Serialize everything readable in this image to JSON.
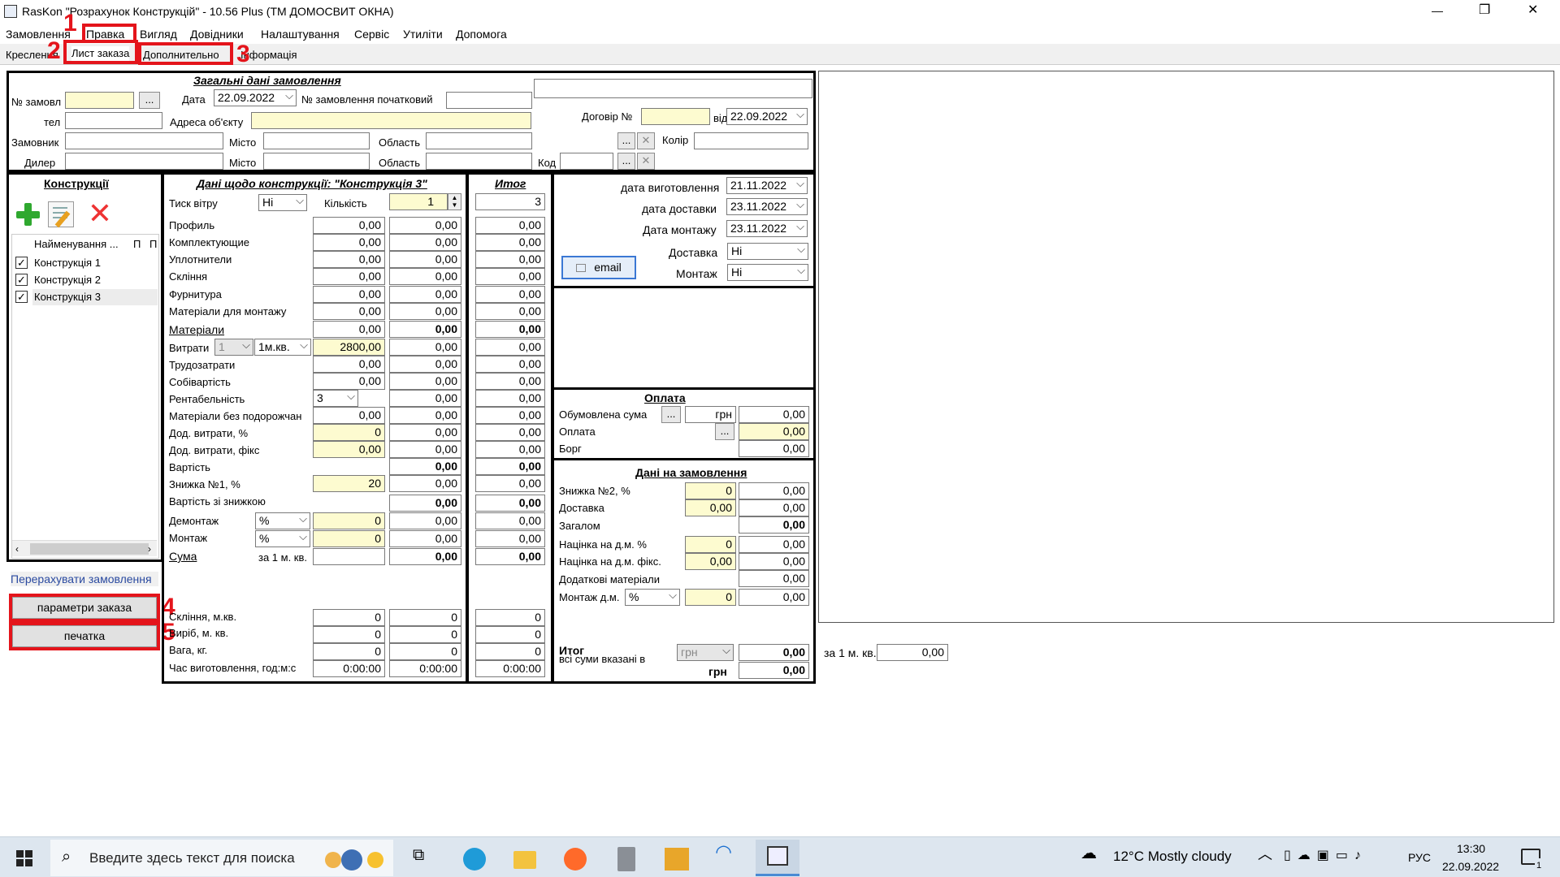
{
  "window": {
    "title": "RasKon \"Розрахунок Конструкцій\" - 10.56 Plus (ТМ ДОМОСВИТ ОКНА)",
    "minimize": "—",
    "maximize": "❐",
    "close": "✕"
  },
  "menu": [
    "Замовлення",
    "Правка",
    "Вигляд",
    "Довідники",
    "Налаштування",
    "Сервіс",
    "Утиліти",
    "Допомога"
  ],
  "tabs": [
    "Креслення",
    "Лист заказа",
    "Дополнительно",
    "Інформація"
  ],
  "markers": [
    "1",
    "2",
    "3",
    "4",
    "5"
  ],
  "general": {
    "title": "Загальні дані замовлення",
    "order_no_label": "№ замовл",
    "date_label": "Дата",
    "date": "22.09.2022",
    "start_no_label": "№ замовлення початковий",
    "phone_label": "тел",
    "address_label": "Адреса об'єкту",
    "contract_label": "Договір №",
    "from_label": "від",
    "contract_date": "22.09.2022",
    "customer_label": "Замовник",
    "city_label": "Місто",
    "region_label": "Область",
    "color_label": "Колір",
    "dealer_label": "Дилер",
    "code_label": "Код",
    "dots": "...",
    "x": "✕"
  },
  "constructions": {
    "title": "Конструкції",
    "col_name": "Найменування ...",
    "col_p1": "П",
    "col_p2": "П",
    "items": [
      "Конструкція 1",
      "Конструкція 2",
      "Конструкція 3"
    ],
    "recalc": "Перерахувати замовлення",
    "params_btn": "параметри заказа",
    "print_btn": "печатка"
  },
  "details": {
    "title": "Дані щодо конструкції: \"Конструкція 3\"",
    "wind_label": "Тиск вітру",
    "wind_value": "Ні",
    "qty_label": "Кількість",
    "qty": "1",
    "total_title": "Итог",
    "total_qty": "3",
    "rows": [
      {
        "label": "Профиль",
        "a": "0,00",
        "b": "0,00",
        "c": "0,00"
      },
      {
        "label": "Комплектующие",
        "a": "0,00",
        "b": "0,00",
        "c": "0,00"
      },
      {
        "label": "Уплотнители",
        "a": "0,00",
        "b": "0,00",
        "c": "0,00"
      },
      {
        "label": "Скління",
        "a": "0,00",
        "b": "0,00",
        "c": "0,00"
      },
      {
        "label": "Фурнитура",
        "a": "0,00",
        "b": "0,00",
        "c": "0,00"
      },
      {
        "label": "Матеріали для монтажу",
        "a": "0,00",
        "b": "0,00",
        "c": "0,00"
      },
      {
        "label": "Матеріали",
        "a": "0,00",
        "b": "0,00",
        "c": "0,00"
      }
    ],
    "expenses_label": "Витрати",
    "expenses_sel1": "1",
    "expenses_sel2": "1м.кв.",
    "expenses_a": "2800,00",
    "expenses_b": "0,00",
    "expenses_c": "0,00",
    "labor_label": "Трудозатрати",
    "labor_a": "0,00",
    "labor_b": "0,00",
    "labor_c": "0,00",
    "cost_label": "Собівартість",
    "cost_a": "0,00",
    "cost_b": "0,00",
    "cost_c": "0,00",
    "profit_label": "Рентабельність",
    "profit_sel": "3",
    "profit_b": "0,00",
    "profit_c": "0,00",
    "mat_nomarkup_label": "Матеріали без подорожчан",
    "mat_nomarkup_a": "0,00",
    "mat_nomarkup_b": "0,00",
    "mat_nomarkup_c": "0,00",
    "extra_pct_label": "Дод. витрати, %",
    "extra_pct_a": "0",
    "extra_pct_b": "0,00",
    "extra_pct_c": "0,00",
    "extra_fix_label": "Дод. витрати, фікс",
    "extra_fix_a": "0,00",
    "extra_fix_b": "0,00",
    "extra_fix_c": "0,00",
    "value_label": "Вартість",
    "value_b": "0,00",
    "value_c": "0,00",
    "disc1_label": "Знижка №1, %",
    "disc1_a": "20",
    "disc1_b": "0,00",
    "disc1_c": "0,00",
    "value_disc_label": "Вартість зі знижкою",
    "value_disc_b": "0,00",
    "value_disc_c": "0,00",
    "dismantle_label": "Демонтаж",
    "dismantle_sel": "%",
    "dismantle_a": "0",
    "dismantle_b": "0,00",
    "dismantle_c": "0,00",
    "mount_label": "Монтаж",
    "mount_sel": "%",
    "mount_a": "0",
    "mount_b": "0,00",
    "mount_c": "0,00",
    "sum_label": "Сума",
    "per_m2_label": "за 1 м. кв.",
    "sum_b": "0,00",
    "sum_c": "0,00",
    "glass_label": "Скління, м.кв.",
    "glass_a": "0",
    "glass_b": "0",
    "glass_c": "0",
    "product_label": "Виріб, м. кв.",
    "product_a": "0",
    "product_b": "0",
    "product_c": "0",
    "weight_label": "Вага, кг.",
    "weight_a": "0",
    "weight_b": "0",
    "weight_c": "0",
    "time_label": "Час виготовлення, год:м:с",
    "time_a": "0:00:00",
    "time_b": "0:00:00",
    "time_c": "0:00:00"
  },
  "dates": {
    "prod_label": "дата виготовлення",
    "prod": "21.11.2022",
    "deliv_label": "дата доставки",
    "deliv": "23.11.2022",
    "mount_label": "Дата монтажу",
    "mount": "23.11.2022",
    "delivery_label": "Доставка",
    "delivery": "Ні",
    "install_label": "Монтаж",
    "install": "Ні",
    "email_btn": "email"
  },
  "payment": {
    "title": "Оплата",
    "agreed_label": "Обумовлена сума",
    "currency": "грн",
    "agreed": "0,00",
    "paid_label": "Оплата",
    "paid": "0,00",
    "debt_label": "Борг",
    "debt": "0,00"
  },
  "order_data": {
    "title": "Дані на замовлення",
    "disc2_label": "Знижка №2, %",
    "disc2_a": "0",
    "disc2_b": "0,00",
    "delivery_label": "Доставка",
    "delivery_a": "0,00",
    "delivery_b": "0,00",
    "total_label": "Загалом",
    "total_b": "0,00",
    "markup_pct_label": "Націнка на д.м. %",
    "markup_pct_a": "0",
    "markup_pct_b": "0,00",
    "markup_fix_label": "Націнка на д.м. фікс.",
    "markup_fix_a": "0,00",
    "markup_fix_b": "0,00",
    "addmat_label": "Додаткові матеріали",
    "addmat_b": "0,00",
    "mountdm_label": "Монтаж д.м.",
    "mountdm_sel": "%",
    "mountdm_a": "0",
    "mountdm_b": "0,00"
  },
  "summary": {
    "itog_label": "Итог",
    "all_sums_label": "всі суми вказані в",
    "currency_sel": "грн",
    "itog1": "0,00",
    "currency": "грн",
    "itog2": "0,00",
    "per_m2_label": "за 1 м. кв.",
    "per_m2": "0,00"
  },
  "taskbar": {
    "search_placeholder": "Введите здесь текст для поиска",
    "weather": "12°C  Mostly cloudy",
    "lang": "РУС",
    "time": "13:30",
    "date": "22.09.2022",
    "notif": "1"
  }
}
